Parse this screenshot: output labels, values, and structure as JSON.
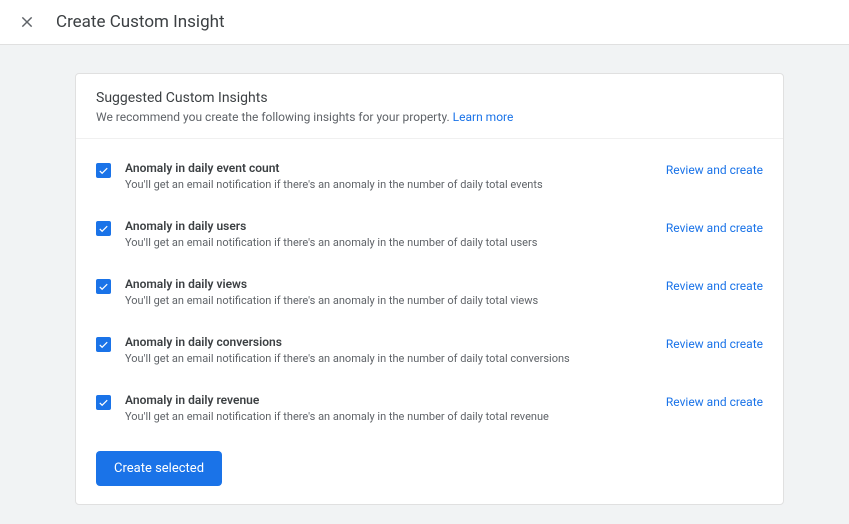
{
  "header": {
    "title": "Create Custom Insight"
  },
  "card": {
    "title": "Suggested Custom Insights",
    "subtitle": "We recommend you create the following insights for your property. ",
    "learn_more": "Learn more"
  },
  "insights": {
    "items": [
      {
        "title": "Anomaly in daily event count",
        "desc": "You'll get an email notification if there's an anomaly in the number of daily total events",
        "action": "Review and create"
      },
      {
        "title": "Anomaly in daily users",
        "desc": "You'll get an email notification if there's an anomaly in the number of daily total users",
        "action": "Review and create"
      },
      {
        "title": "Anomaly in daily views",
        "desc": "You'll get an email notification if there's an anomaly in the number of daily total views",
        "action": "Review and create"
      },
      {
        "title": "Anomaly in daily conversions",
        "desc": "You'll get an email notification if there's an anomaly in the number of daily total conversions",
        "action": "Review and create"
      },
      {
        "title": "Anomaly in daily revenue",
        "desc": "You'll get an email notification if there's an anomaly in the number of daily total revenue",
        "action": "Review and create"
      }
    ]
  },
  "footer": {
    "create_button": "Create selected"
  }
}
